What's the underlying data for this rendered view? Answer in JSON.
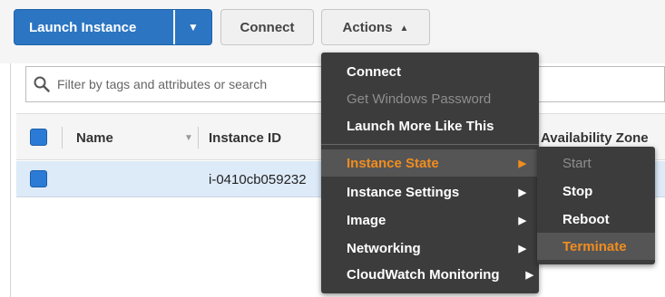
{
  "toolbar": {
    "launch_label": "Launch Instance",
    "connect_label": "Connect",
    "actions_label": "Actions"
  },
  "filter": {
    "placeholder": "Filter by tags and attributes or search"
  },
  "table": {
    "columns": [
      "Name",
      "Instance ID",
      "Availability Zone"
    ],
    "rows": [
      {
        "name": "",
        "instance_id": "i-0410cb059232"
      }
    ]
  },
  "actions_menu": {
    "items": [
      {
        "label": "Connect",
        "disabled": false
      },
      {
        "label": "Get Windows Password",
        "disabled": true
      },
      {
        "label": "Launch More Like This",
        "disabled": false
      },
      {
        "label": "Instance State",
        "submenu": true,
        "highlighted": true
      },
      {
        "label": "Instance Settings",
        "submenu": true
      },
      {
        "label": "Image",
        "submenu": true
      },
      {
        "label": "Networking",
        "submenu": true
      },
      {
        "label": "CloudWatch Monitoring",
        "submenu": true
      }
    ]
  },
  "instance_state_menu": {
    "items": [
      {
        "label": "Start",
        "disabled": true
      },
      {
        "label": "Stop",
        "disabled": false
      },
      {
        "label": "Reboot",
        "disabled": false
      },
      {
        "label": "Terminate",
        "highlighted": true
      }
    ]
  },
  "colors": {
    "primary": "#2b75c2",
    "menu_bg": "#3c3c3c",
    "menu_highlight_text": "#f08d1f",
    "row_selected": "#ddeaf8"
  },
  "icons": [
    "chevron-down-icon",
    "chevron-up-icon",
    "search-icon",
    "sort-caret-icon",
    "submenu-arrow-icon",
    "checkbox-icon"
  ]
}
